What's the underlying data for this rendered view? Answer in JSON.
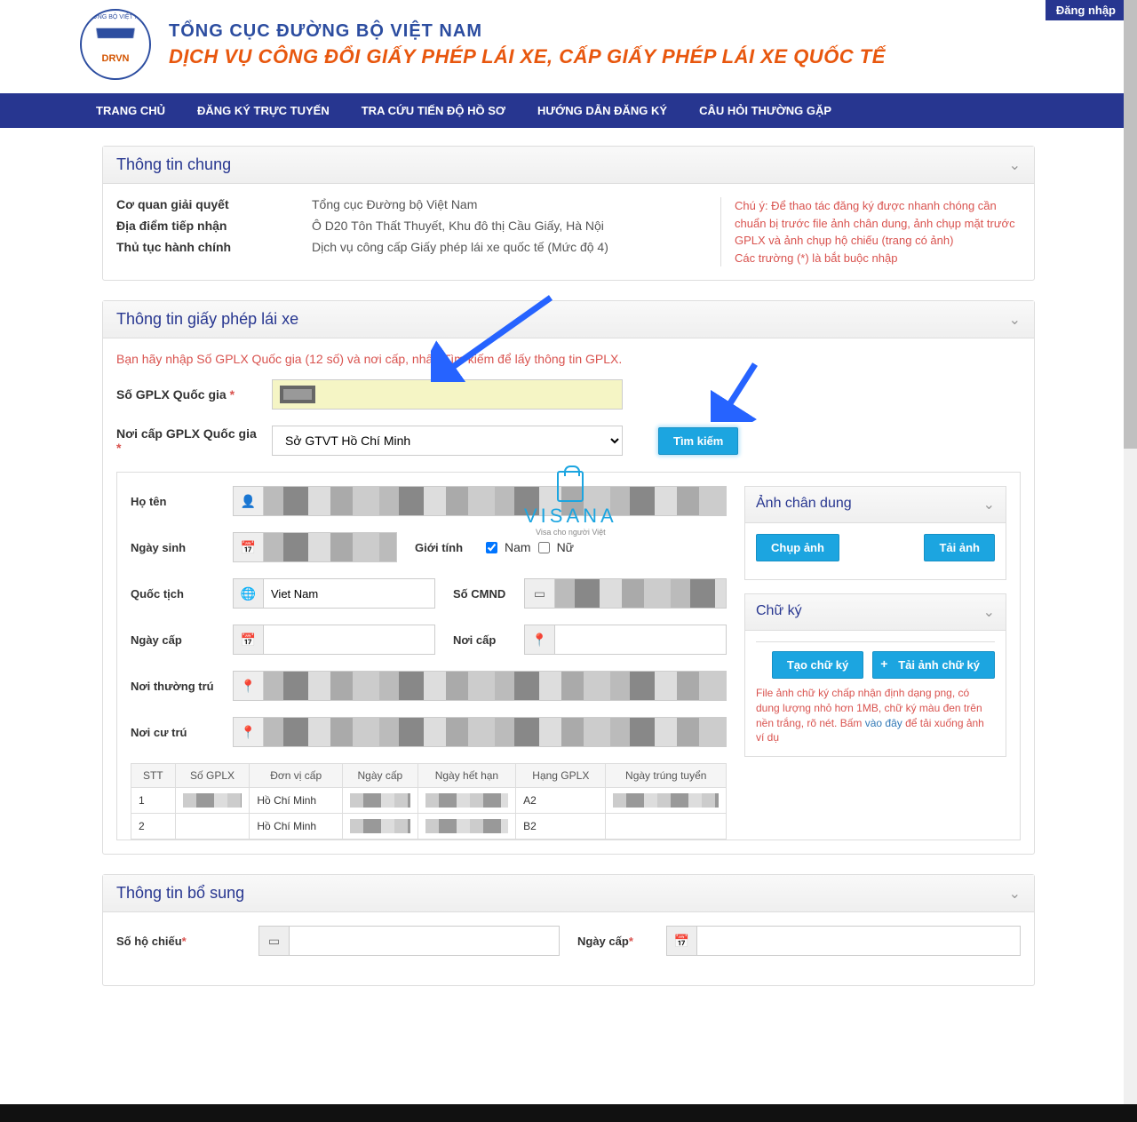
{
  "login_button": "Đăng nhập",
  "header": {
    "logo_top": "ĐƯỜNG BỘ VIỆT NAM",
    "logo_sub": "DRVN",
    "title": "TỔNG CỤC ĐƯỜNG BỘ VIỆT NAM",
    "subtitle": "DỊCH VỤ CÔNG ĐỔI GIẤY PHÉP LÁI XE, CẤP GIẤY PHÉP LÁI XE QUỐC TẾ"
  },
  "nav": [
    "TRANG CHỦ",
    "ĐĂNG KÝ TRỰC TUYẾN",
    "TRA CỨU TIẾN ĐỘ HỒ SƠ",
    "HƯỚNG DẪN ĐĂNG KÝ",
    "CÂU HỎI THƯỜNG GẶP"
  ],
  "panel1": {
    "title": "Thông tin chung",
    "rows": [
      {
        "label": "Cơ quan giải quyết",
        "value": "Tổng cục Đường bộ Việt Nam"
      },
      {
        "label": "Địa điểm tiếp nhận",
        "value": "Ô D20 Tôn Thất Thuyết, Khu đô thị Cầu Giấy, Hà Nội"
      },
      {
        "label": "Thủ tục hành chính",
        "value": "Dịch vụ công cấp Giấy phép lái xe quốc tế (Mức độ 4)"
      }
    ],
    "note1": "Chú ý: Để thao tác đăng ký được nhanh chóng cần chuẩn bị trước file ảnh chân dung, ảnh chụp mặt trước GPLX và ảnh chụp hộ chiếu (trang có ảnh)",
    "note2": "Các trường (*) là bắt buộc nhập"
  },
  "panel2": {
    "title": "Thông tin giấy phép lái xe",
    "instruction": "Bạn hãy nhập Số GPLX Quốc gia (12 số) và nơi cấp, nhấn Tìm kiếm để lấy thông tin GPLX.",
    "gplx_label": "Số GPLX Quốc gia",
    "place_label": "Nơi cấp GPLX Quốc gia",
    "place_value": "Sở GTVT Hồ Chí Minh",
    "search_btn": "Tìm kiếm",
    "form": {
      "fullname": "Họ tên",
      "dob": "Ngày sinh",
      "gender": "Giới tính",
      "male": "Nam",
      "female": "Nữ",
      "nationality": "Quốc tịch",
      "nationality_value": "Viet Nam",
      "cmnd": "Số CMND",
      "issue_date": "Ngày cấp",
      "issue_place": "Nơi cấp",
      "perm_addr": "Nơi thường trú",
      "curr_addr": "Nơi cư trú"
    },
    "side": {
      "portrait_title": "Ảnh chân dung",
      "capture": "Chụp ảnh",
      "upload": "Tải ảnh",
      "sig_title": "Chữ ký",
      "create_sig": "Tạo chữ ký",
      "upload_sig": "Tải ảnh chữ ký",
      "sig_note": "File ảnh chữ ký chấp nhận định dạng png, có dung lượng nhỏ hơn 1MB, chữ ký màu đen trên nền trắng, rõ nét. Bấm ",
      "sig_link": "vào đây",
      "sig_note2": " để tải xuống ảnh ví dụ"
    },
    "table": {
      "headers": [
        "STT",
        "Số GPLX",
        "Đơn vị cấp",
        "Ngày cấp",
        "Ngày hết hạn",
        "Hạng GPLX",
        "Ngày trúng tuyển"
      ],
      "rows": [
        {
          "stt": "1",
          "donvi": "Hồ Chí Minh",
          "hang": "A2"
        },
        {
          "stt": "2",
          "donvi": "Hồ Chí Minh",
          "hang": "B2"
        }
      ]
    }
  },
  "panel3": {
    "title": "Thông tin bổ sung",
    "passport": "Số hộ chiếu",
    "issue_date": "Ngày cấp"
  },
  "watermark": {
    "brand": "VISANA",
    "tag": "Visa cho người Việt"
  }
}
